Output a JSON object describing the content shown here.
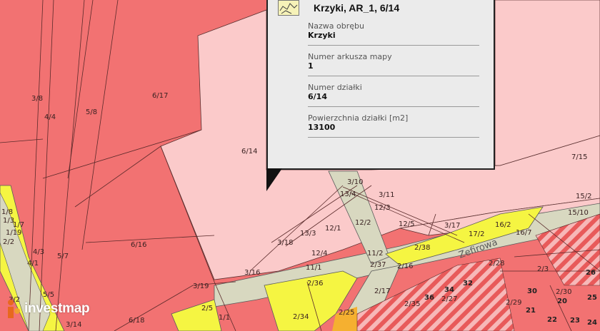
{
  "popup": {
    "title": "Krzyki, AR_1, 6/14",
    "icon": "parcel-polygon-icon",
    "fields": [
      {
        "label": "Nazwa obrębu",
        "value": "Krzyki"
      },
      {
        "label": "Numer arkusza mapy",
        "value": "1"
      },
      {
        "label": "Numer działki",
        "value": "6/14"
      },
      {
        "label": "Powierzchnia działki [m2]",
        "value": "13100"
      }
    ]
  },
  "logo": {
    "text": "investmap",
    "icon": "investmap-logo-icon"
  },
  "street": {
    "name": "Zefirowa"
  },
  "parcels": [
    "3/8",
    "4/4",
    "5/8",
    "6/17",
    "6/14",
    "7/15",
    "15/2",
    "15/10",
    "16/2",
    "16/7",
    "17/2",
    "11/2",
    "11/1",
    "12/3",
    "12/5",
    "12/2",
    "12/1",
    "12/4",
    "13/3",
    "13/4",
    "3/10",
    "3/11",
    "3/17",
    "2/38",
    "2/37",
    "2/16",
    "2/36",
    "2/17",
    "2/34",
    "2/35",
    "2/25",
    "2/27",
    "2/28",
    "2/29",
    "2/30",
    "2/3",
    "3/18",
    "3/16",
    "3/19",
    "3/14",
    "6/16",
    "6/18",
    "5/7",
    "4/3",
    "4/1",
    "5/5",
    "3/2",
    "1/1",
    "1/3",
    "1/19",
    "1/7",
    "1/8",
    "2/2",
    "2/5",
    "30",
    "34",
    "36",
    "32",
    "20",
    "22",
    "21",
    "23",
    "24",
    "25",
    "26"
  ],
  "colors": {
    "parcel_red": "#f27272",
    "parcel_pink": "#fbcaca",
    "road_yellow": "#f5f542",
    "road_gray": "#d8d8c0",
    "hatch_red": "#e85a5a",
    "popup_bg": "#ebebeb"
  }
}
